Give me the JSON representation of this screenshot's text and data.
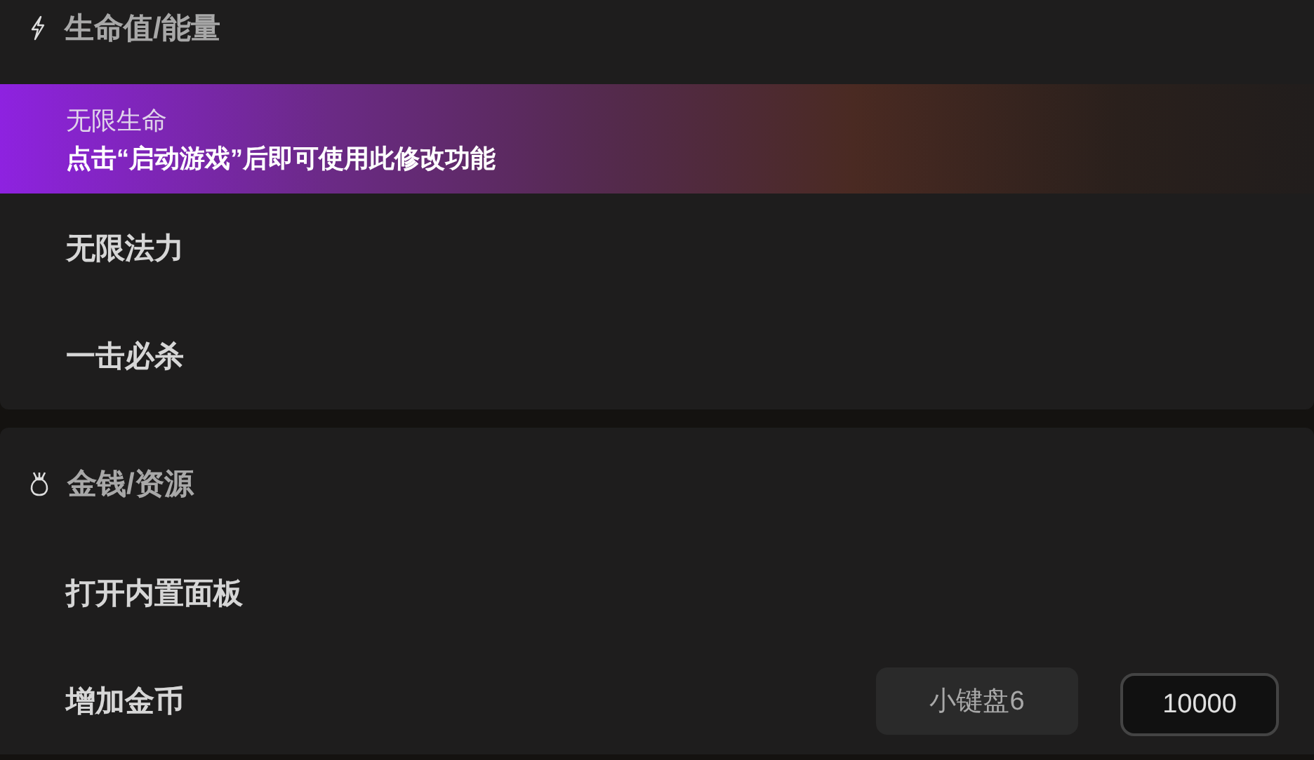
{
  "sections": [
    {
      "title": "生命值/能量",
      "kind": "energy",
      "items": [
        {
          "label": "无限生命",
          "selected": true,
          "hint": "点击“启动游戏”后即可使用此修改功能"
        },
        {
          "label": "无限法力",
          "selected": false
        },
        {
          "label": "一击必杀",
          "selected": false
        }
      ]
    },
    {
      "title": "金钱/资源",
      "kind": "money",
      "items": [
        {
          "label": "打开内置面板",
          "selected": false
        },
        {
          "label": "增加金币",
          "selected": false,
          "hotkey": "小键盘6",
          "value": "10000"
        }
      ]
    }
  ]
}
